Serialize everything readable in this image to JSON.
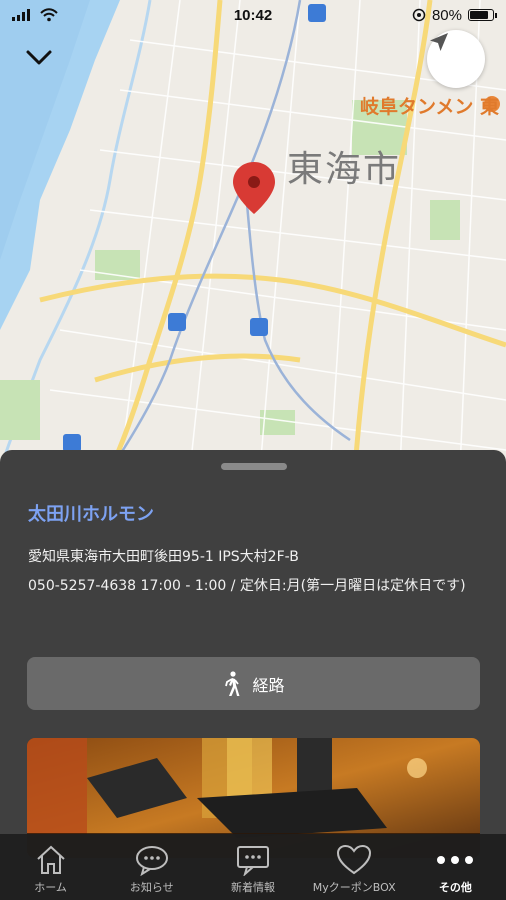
{
  "status_bar": {
    "time": "10:42",
    "battery": "80%",
    "battery_level": 0.8
  },
  "map": {
    "city_label": "東海市",
    "poi_label": "岐阜タンメン 東"
  },
  "shop": {
    "name": "太田川ホルモン",
    "address": "愛知県東海市大田町後田95-1 IPS大村2F-B",
    "details": "050-5257-4638 17:00 - 1:00 / 定休日:月(第一月曜日は定休日です)"
  },
  "route_button": {
    "label": "経路",
    "icon": "walking-icon"
  },
  "tabs": [
    {
      "label": "ホーム",
      "icon": "home-icon"
    },
    {
      "label": "お知らせ",
      "icon": "chat-bubble-icon"
    },
    {
      "label": "新着情報",
      "icon": "message-icon"
    },
    {
      "label": "MyクーポンBOX",
      "icon": "heart-icon"
    },
    {
      "label": "その他",
      "icon": "more-icon"
    }
  ],
  "colors": {
    "accent": "#7da2f2",
    "sheet": "#404040",
    "pin": "#d83a34",
    "poi": "#e07a2c"
  }
}
